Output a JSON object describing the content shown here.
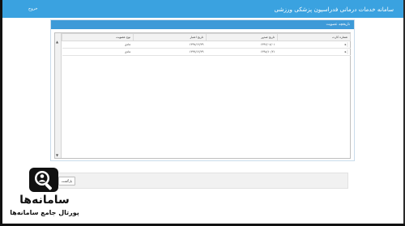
{
  "header": {
    "title": "سامانه خدمات درمانی فدراسیون پزشکی ورزشی",
    "exit_label": "خروج"
  },
  "panel": {
    "title": "تاریخچه عضویت"
  },
  "table": {
    "columns": [
      "شماره کارت",
      "تاریخ صدور",
      "تاریخ اعتبار",
      "نوع عضویت"
    ],
    "rows": [
      {
        "card_number": "",
        "issue_date": "۱۳۹۶/۰۸/۰۱",
        "expiry_date": "۱۳۹۷/۱۲/۲۹",
        "type": "عادی"
      },
      {
        "card_number": "",
        "issue_date": "۱۳۹۸/۱۰/۲۱",
        "expiry_date": "۱۳۹۹/۱۲/۲۹",
        "type": "عادی"
      }
    ]
  },
  "footer": {
    "back_label": "بازگشت"
  },
  "logo": {
    "main": "سامانه‌ها",
    "sub": "پورتال جامع سامانه‌ها"
  },
  "colors": {
    "topbar": "#3aa2e0",
    "panel_header": "#3d9ad8"
  },
  "icons": {
    "scroll_up": "chevron-up-icon",
    "scroll_down": "chevron-down-icon",
    "row_pointer": "triangle-right-icon",
    "logo": "magnifier-person-icon"
  }
}
